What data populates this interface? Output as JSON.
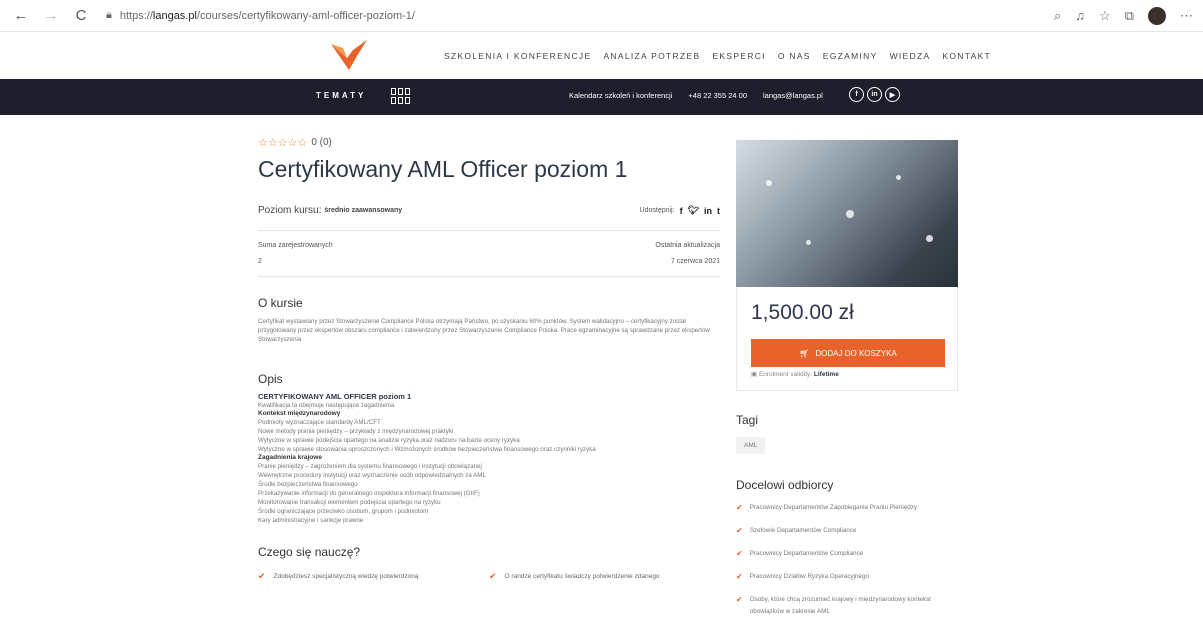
{
  "browser": {
    "back": "←",
    "forward": "→",
    "reload": "C",
    "url_prefix": "https://",
    "url_host": "langas.pl",
    "url_path": "/courses/certyfikowany-aml-officer-poziom-1/"
  },
  "nav": {
    "items": [
      "SZKOLENIA I KONFERENCJE",
      "ANALIZA POTRZEB",
      "EKSPERCI",
      "O NAS",
      "EGZAMINY",
      "WIEDZA",
      "KONTAKT"
    ]
  },
  "topbar": {
    "tematy": "TEMATY",
    "calendar": "Kalendarz szkoleń i konferencji",
    "phone": "+48 22 355 24 00",
    "email": "langas@langas.pl"
  },
  "course": {
    "stars": "☆☆☆☆☆",
    "rating": "0 (0)",
    "title": "Certyfikowany AML Officer poziom 1",
    "level_label": "Poziom kursu:",
    "level_value": "średnio zaawansowany",
    "share_label": "Udostępnij:",
    "enrolled_label": "Suma zarejestrowanych",
    "enrolled_value": "2",
    "updated_label": "Ostatnia aktualizacja",
    "updated_value": "7 czerwca 2021"
  },
  "about": {
    "heading": "O kursie",
    "text": "Certyfikat wystawiany przez Stowarzyszenie Compliance Polska otrzymają Państwo, po uzyskaniu 60% punktów. System walidacyjno – certyfikacyjny został przygotowany przez ekspertów obszaru compliance i zatwierdzony przez Stowarzyszenie Compliance Polska. Prace egzaminacyjne są sprawdzane przez ekspertów Stowarzyszenia"
  },
  "opis": {
    "heading": "Opis",
    "title": "CERTYFIKOWANY AML OFFICER poziom 1",
    "intro": "Kwalifikacja ta obejmuje następujące zagadnienia",
    "section1": "Kontekst międzynarodowy",
    "items1": [
      "Podmioty wyznaczające standardy AML/CFT",
      "Nowe metody prania pieniędzy – przykłady z międzynarodowej praktyki",
      "Wytyczne w sprawie podejścia opartego na analizie ryzyka oraz nadzoru na bazie oceny ryzyka",
      "Wytyczne w sprawie stosowania uproszczonych i Wzmożonych środków bezpieczeństwa finansowego oraz czynniki ryzyka"
    ],
    "section2": "Zagadnienia krajowe",
    "items2": [
      "Pranie pieniędzy – zagrożeniem dla systemu finansowego i instytucji obowiązanej",
      "Wewnętrzne procedury instytucji oraz wyznaczenie osób odpowiedzialnych za AML",
      "Środki bezpieczeństwa finansowego",
      "Przekazywanie informacji do generalnego inspektora informacji finansowej (GIIF)",
      "Monitorowanie transakcji elementem podejścia opartego na ryzyku",
      "Środki ograniczające przeciwko osobom, grupom i podmiotom",
      "Kary administracyjne i sankcje prawne"
    ]
  },
  "learn": {
    "heading": "Czego się nauczę?",
    "items": [
      "Zdobędziesz specjalistyczną wiedzę potwierdzoną",
      "O randze certyfikatu świadczy potwierdzenie zdanego"
    ]
  },
  "sidebar": {
    "price": "1,500.00 zł",
    "cart_button": "DODAJ DO KOSZYKA",
    "validity_label": "Enrolment validity:",
    "validity_value": "Lifetime",
    "tags_heading": "Tagi",
    "tag": "AML",
    "audience_heading": "Docelowi odbiorcy",
    "audience": [
      "Pracownicy Departamentów Zapobiegania Praniu Pieniędzy",
      "Szefowie Departamentów Compliance",
      "Pracownicy Departamentów Compliance",
      "Pracownicy Działów Ryzyka Operacyjnego",
      "Osoby, które chcą zrozumieć krajowy i międzynarodowy kontekst obowiązków w zakresie AML"
    ]
  },
  "colors": {
    "accent": "#e8632a",
    "dark": "#1d1f2c",
    "title": "#2c3848"
  }
}
